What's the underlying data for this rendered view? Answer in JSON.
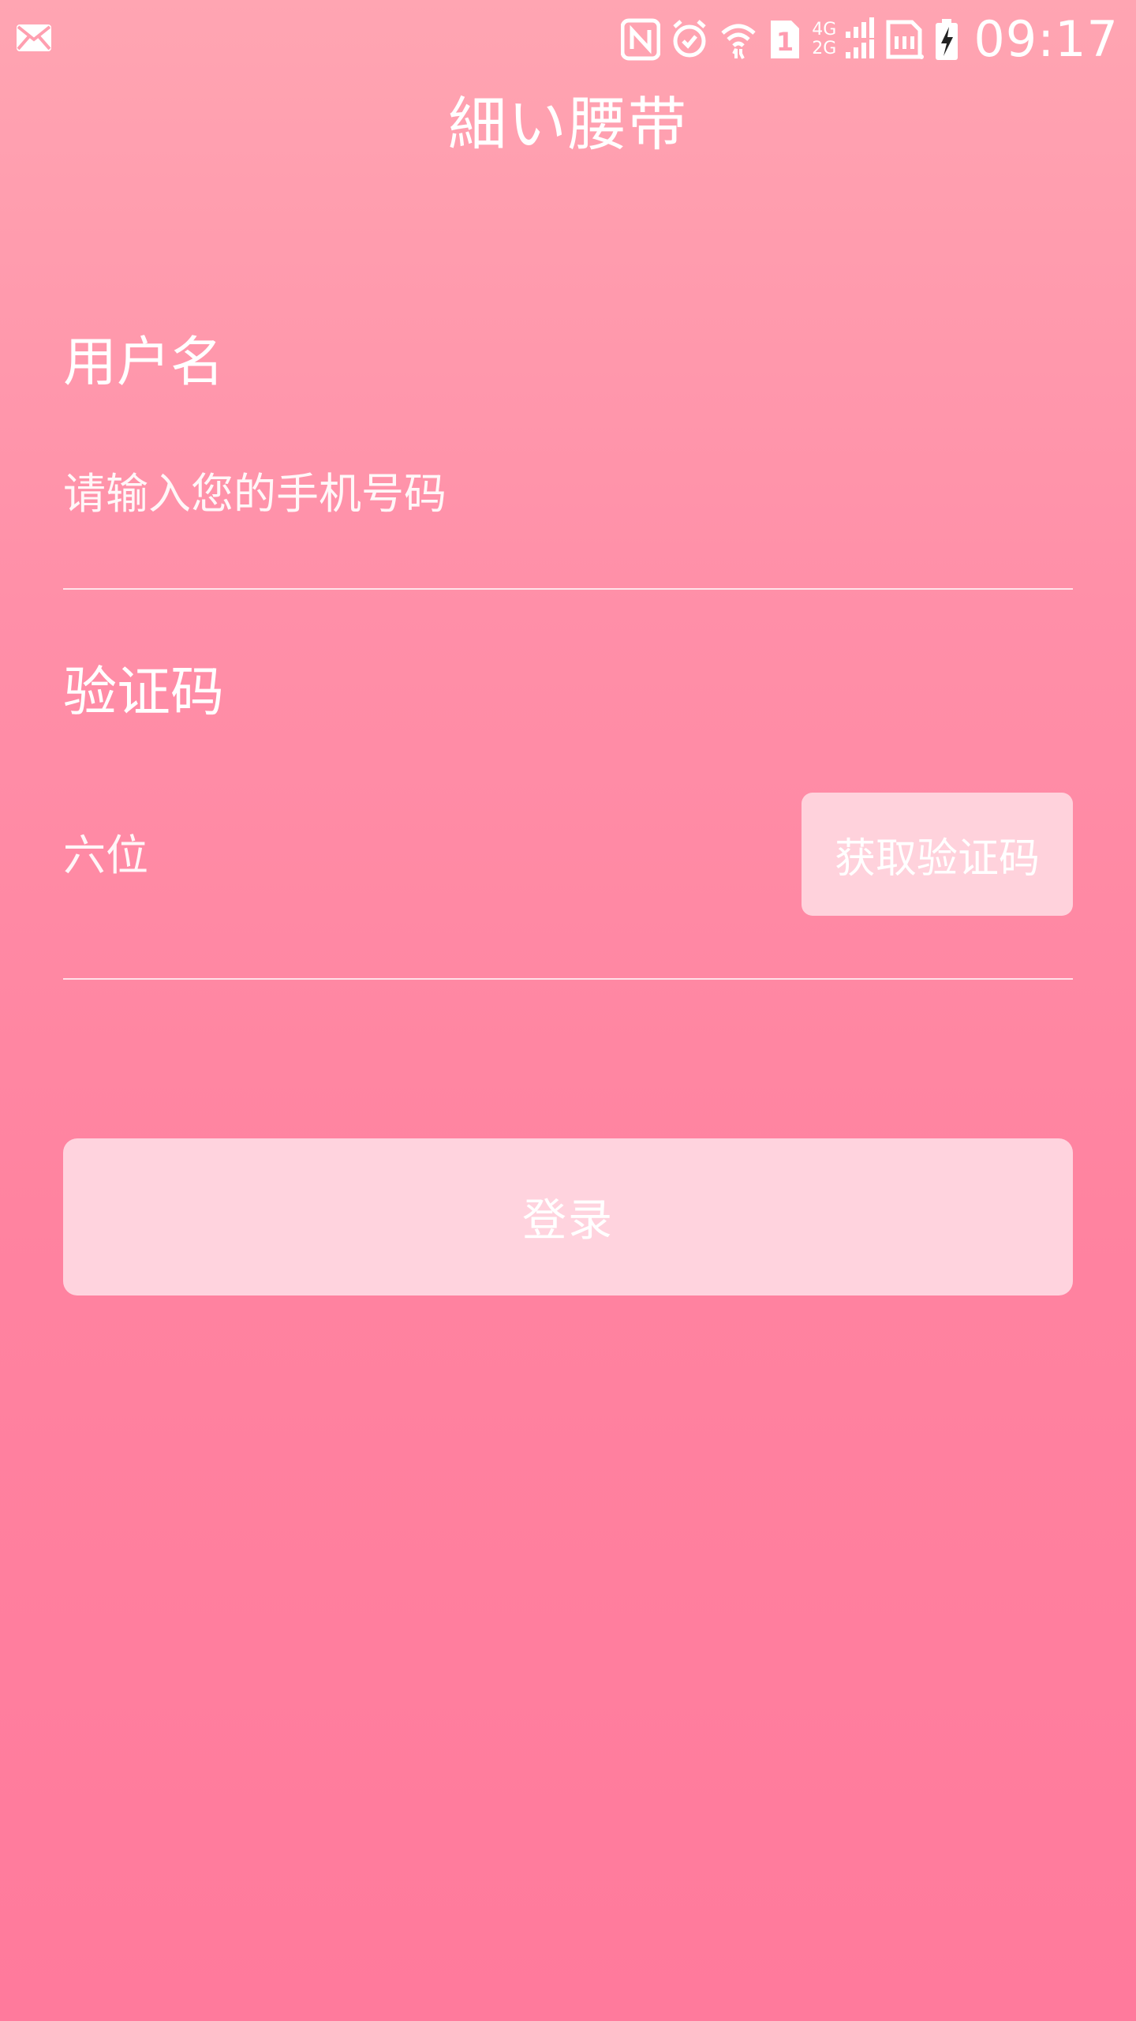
{
  "status_bar": {
    "time": "09:17",
    "net_upper": "4G",
    "net_lower": "2G",
    "sim_slot": "1",
    "icons": [
      "mail-icon",
      "nfc-icon",
      "alarm-icon",
      "wifi-icon",
      "sim-1-icon",
      "signal-icon",
      "sim-card-icon",
      "battery-charging-icon"
    ]
  },
  "header": {
    "title": "細い腰带"
  },
  "form": {
    "username_label": "用户名",
    "phone_placeholder": "请输入您的手机号码",
    "code_label": "验证码",
    "code_placeholder": "六位",
    "get_code_button": "获取验证码",
    "login_button": "登录"
  },
  "colors": {
    "gradient_top": "#ffa5b2",
    "gradient_bottom": "#ff7a9c",
    "button_bg": "#ffdce4",
    "text": "#ffffff"
  }
}
